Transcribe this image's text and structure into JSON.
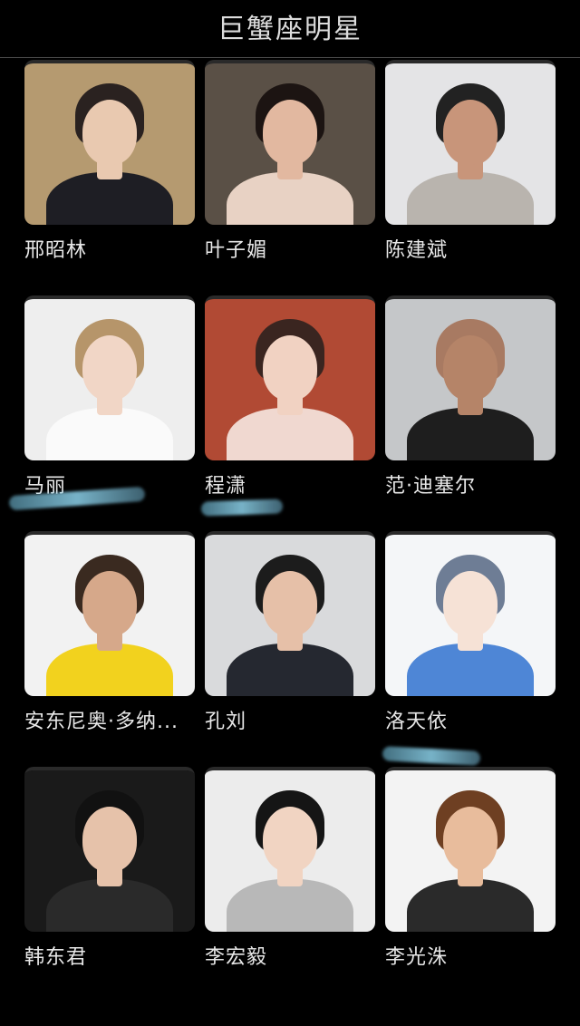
{
  "header": {
    "title": "巨蟹座明星"
  },
  "stars": [
    {
      "name": "邢昭林",
      "bg": "#b59a70",
      "skin": "#e9c9b0",
      "hair": "#2a2220",
      "shirt": "#1e1e24"
    },
    {
      "name": "叶子媚",
      "bg": "#5a5046",
      "skin": "#e2b8a0",
      "hair": "#1c1412",
      "shirt": "#e8d2c4"
    },
    {
      "name": "陈建斌",
      "bg": "#e4e4e6",
      "skin": "#c8957a",
      "hair": "#222222",
      "shirt": "#b9b4ae"
    },
    {
      "name": "马丽",
      "bg": "#eeeeee",
      "skin": "#f1d6c6",
      "hair": "#b6956a",
      "shirt": "#fafafa"
    },
    {
      "name": "程潇",
      "bg": "#b14a34",
      "skin": "#f1d2c2",
      "hair": "#3a2520",
      "shirt": "#f0d8d0"
    },
    {
      "name": "范·迪塞尔",
      "bg": "#c5c7c9",
      "skin": "#b58468",
      "hair": "#a87a62",
      "shirt": "#1e1e1e"
    },
    {
      "name": "安东尼奥·多纳...",
      "bg": "#f2f2f2",
      "skin": "#d6a88a",
      "hair": "#3a2a20",
      "shirt": "#f2d21e"
    },
    {
      "name": "孔刘",
      "bg": "#d9dadc",
      "skin": "#e6c0a8",
      "hair": "#1c1c1c",
      "shirt": "#252830"
    },
    {
      "name": "洛天依",
      "bg": "#f4f6f8",
      "skin": "#f6e2d6",
      "hair": "#6e7d95",
      "shirt": "#4e86d6"
    },
    {
      "name": "韩东君",
      "bg": "#1a1a1a",
      "skin": "#e6c2aa",
      "hair": "#111111",
      "shirt": "#2a2a2a"
    },
    {
      "name": "李宏毅",
      "bg": "#ececec",
      "skin": "#f1d4c2",
      "hair": "#151515",
      "shirt": "#b8b8b8"
    },
    {
      "name": "李光洙",
      "bg": "#f3f3f3",
      "skin": "#e8bc9c",
      "hair": "#6e3f22",
      "shirt": "#2a2a2a"
    }
  ],
  "scribble_color": "#8fd0ea"
}
